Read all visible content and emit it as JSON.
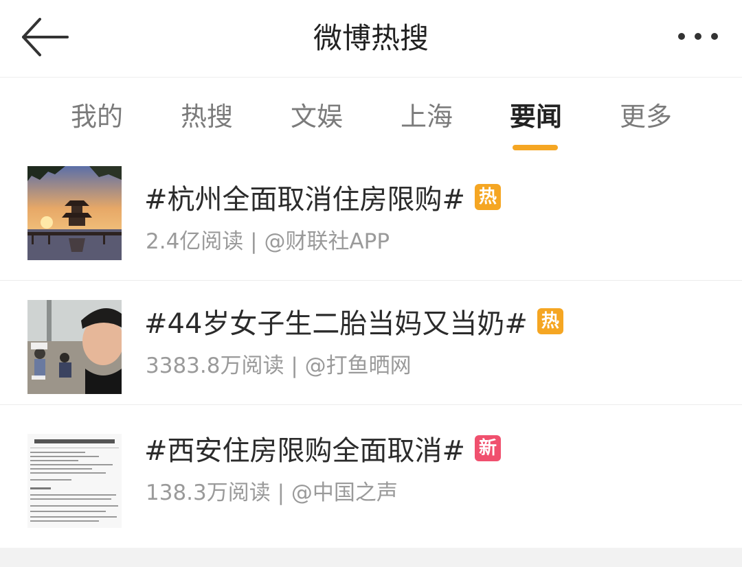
{
  "header": {
    "title": "微博热搜",
    "back_icon": "arrow-left-icon",
    "more_icon": "more-horizontal-icon"
  },
  "tabs": [
    {
      "label": "我的",
      "active": false
    },
    {
      "label": "热搜",
      "active": false
    },
    {
      "label": "文娱",
      "active": false
    },
    {
      "label": "上海",
      "active": false
    },
    {
      "label": "要闻",
      "active": true
    },
    {
      "label": "更多",
      "active": false
    }
  ],
  "accent_color": "#f5a623",
  "items": [
    {
      "topic": "#杭州全面取消住房限购#",
      "badge": "热",
      "badge_color": "#f5a623",
      "reads": "2.4亿阅读",
      "separator": " | ",
      "source": "@财联社APP",
      "thumb": "pavilion-lake-sunset"
    },
    {
      "topic": "#44岁女子生二胎当妈又当奶#",
      "badge": "热",
      "badge_color": "#f5a623",
      "reads": "3383.8万阅读",
      "separator": " | ",
      "source": "@打鱼晒网",
      "thumb": "woman-selfie-kids"
    },
    {
      "topic": "#西安住房限购全面取消#",
      "badge": "新",
      "badge_color": "#f0506e",
      "reads": "138.3万阅读",
      "separator": " | ",
      "source": "@中国之声",
      "thumb": "document-notice"
    }
  ]
}
